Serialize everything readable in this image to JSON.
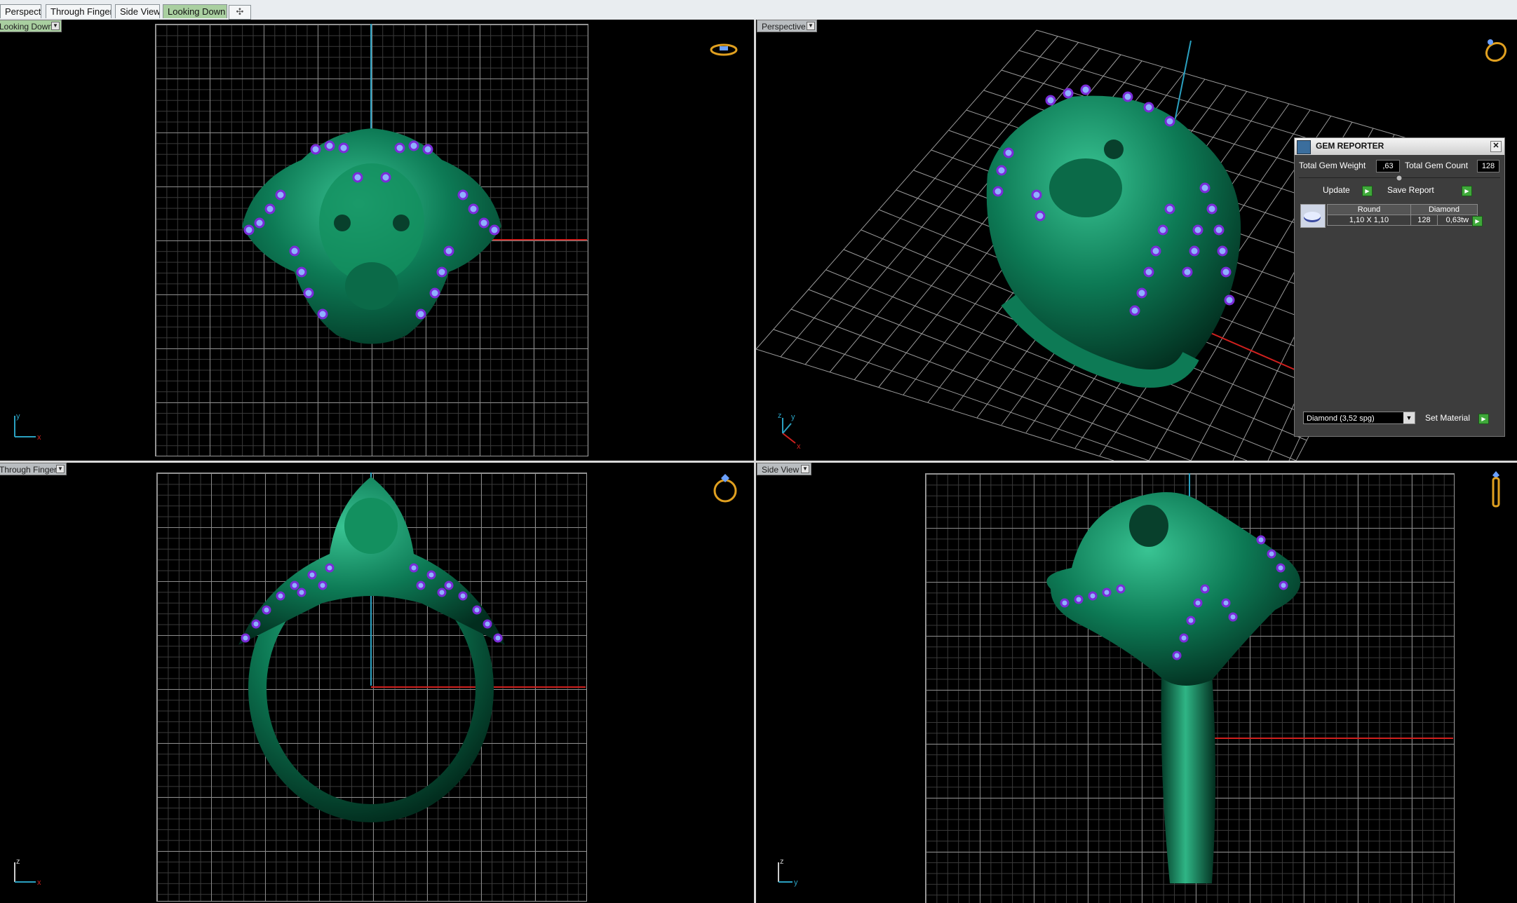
{
  "tabs": [
    {
      "label": "Perspective",
      "active": false
    },
    {
      "label": "Through Finger",
      "active": false
    },
    {
      "label": "Side View",
      "active": false
    },
    {
      "label": "Looking Down",
      "active": true
    }
  ],
  "tab_add_label": "✣",
  "viewports": {
    "top_left": {
      "label": "Looking Down",
      "axis": {
        "v": "y",
        "h": "x"
      }
    },
    "top_right": {
      "label": "Perspective",
      "axis": {
        "v": "y",
        "h": "x",
        "d": "z"
      }
    },
    "bottom_left": {
      "label": "Through Finger",
      "axis": {
        "v": "z",
        "h": "x"
      }
    },
    "bottom_right": {
      "label": "Side View",
      "axis": {
        "v": "z",
        "h": "y"
      }
    }
  },
  "gem_reporter": {
    "title": "GEM REPORTER",
    "close_label": "✕",
    "total_weight_label": "Total Gem Weight",
    "total_weight_value": ",63",
    "total_count_label": "Total Gem Count",
    "total_count_value": "128",
    "update_label": "Update",
    "save_report_label": "Save Report",
    "table": {
      "headers": [
        "Round",
        "Diamond"
      ],
      "size": "1,10 X 1,10",
      "count": "128",
      "weight": "0,63tw"
    },
    "material_select": "Diamond     (3,52 spg)",
    "set_material_label": "Set Material"
  },
  "colors": {
    "metal": "#0d7a55",
    "gem": "#8fb0ff",
    "prong": "#7a2bd8",
    "axis_x": "#d0201e",
    "axis_y": "#2aa0c0"
  }
}
